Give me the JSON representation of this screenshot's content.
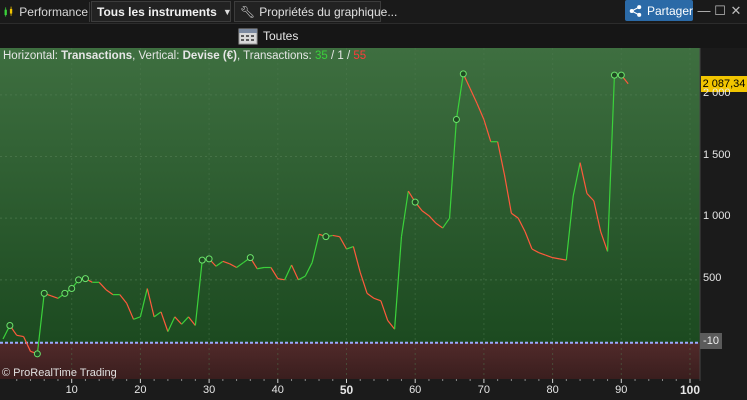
{
  "toolbar": {
    "app_label": "Performance",
    "instrument_selector": "Tous les instruments",
    "chart_properties": "Propriétés du graphique...",
    "share_label": "Partager",
    "minimize": "—",
    "maximize": "☐",
    "close": "✕"
  },
  "period": {
    "label": "Toutes"
  },
  "legend": {
    "horizontal_prefix": "Horizontal: ",
    "horizontal_value": "Transactions",
    "vertical_prefix": ", Vertical: ",
    "vertical_value": "Devise (€)",
    "transactions_prefix": ", Transactions: ",
    "winning": "35",
    "sep1": " / ",
    "neutral": "1",
    "sep2": " / ",
    "losing": "55"
  },
  "copyright": "© ProRealTime Trading",
  "price_label": "2 087,34",
  "zero_label": "-10",
  "colors": {
    "up": "#3bd23b",
    "down": "#ff5a3c",
    "gain_area": "#2f5a31",
    "loss_area": "#4a2626",
    "price_tag": "#f2c500",
    "share": "#2b6aa7"
  },
  "chart_data": {
    "type": "line",
    "xlabel": "",
    "ylabel": "",
    "xlim": [
      0,
      100
    ],
    "ylim": [
      -300,
      2300
    ],
    "x_ticks": [
      {
        "v": 10,
        "label": "10",
        "major": false
      },
      {
        "v": 20,
        "label": "20",
        "major": false
      },
      {
        "v": 30,
        "label": "30",
        "major": false
      },
      {
        "v": 40,
        "label": "40",
        "major": false
      },
      {
        "v": 50,
        "label": "50",
        "major": true
      },
      {
        "v": 60,
        "label": "60",
        "major": false
      },
      {
        "v": 70,
        "label": "70",
        "major": false
      },
      {
        "v": 80,
        "label": "80",
        "major": false
      },
      {
        "v": 90,
        "label": "90",
        "major": false
      },
      {
        "v": 100,
        "label": "100",
        "major": true
      }
    ],
    "y_ticks": [
      {
        "v": 500,
        "label": "500"
      },
      {
        "v": 1000,
        "label": "1 000"
      },
      {
        "v": 1500,
        "label": "1 500"
      },
      {
        "v": 2000,
        "label": "2 000"
      }
    ],
    "zero_line": -10,
    "last_value": 2087.34,
    "series": [
      {
        "x": [
          0,
          1,
          2,
          3,
          4,
          5,
          6,
          7,
          8,
          9,
          10,
          11,
          12,
          13,
          14,
          15,
          16,
          17,
          18,
          19,
          20,
          21,
          22,
          23,
          24,
          25,
          26,
          27,
          28,
          29,
          30,
          31,
          32,
          33,
          34,
          35,
          36,
          37,
          38,
          39,
          40,
          41,
          42,
          43,
          44,
          45,
          46,
          47,
          48,
          49,
          50,
          51,
          52,
          53,
          54,
          55,
          56,
          57,
          58,
          59,
          60,
          61,
          62,
          63,
          64,
          65,
          66,
          67,
          68,
          69,
          70,
          71,
          72,
          73,
          74,
          75,
          76,
          77,
          78,
          79,
          80,
          81,
          82,
          83,
          84,
          85,
          86,
          87,
          88,
          89,
          90,
          91
        ],
        "y": [
          20,
          130,
          50,
          40,
          -80,
          -100,
          390,
          370,
          350,
          390,
          430,
          500,
          510,
          480,
          480,
          420,
          380,
          380,
          310,
          180,
          200,
          430,
          200,
          240,
          80,
          200,
          140,
          200,
          130,
          660,
          670,
          610,
          650,
          630,
          600,
          640,
          680,
          590,
          600,
          600,
          510,
          500,
          620,
          500,
          530,
          640,
          870,
          850,
          860,
          850,
          750,
          770,
          560,
          390,
          350,
          330,
          170,
          100,
          850,
          1220,
          1130,
          1060,
          1020,
          960,
          920,
          1000,
          1800,
          2170,
          2050,
          1930,
          1800,
          1620,
          1620,
          1350,
          1040,
          1000,
          890,
          750,
          720,
          700,
          680,
          670,
          660,
          1180,
          1450,
          1200,
          1140,
          890,
          730,
          2160,
          2160,
          2090
        ]
      }
    ],
    "markers_x": [
      1,
      5,
      6,
      9,
      10,
      11,
      12,
      29,
      30,
      36,
      47,
      60,
      66,
      67,
      89,
      90
    ]
  }
}
